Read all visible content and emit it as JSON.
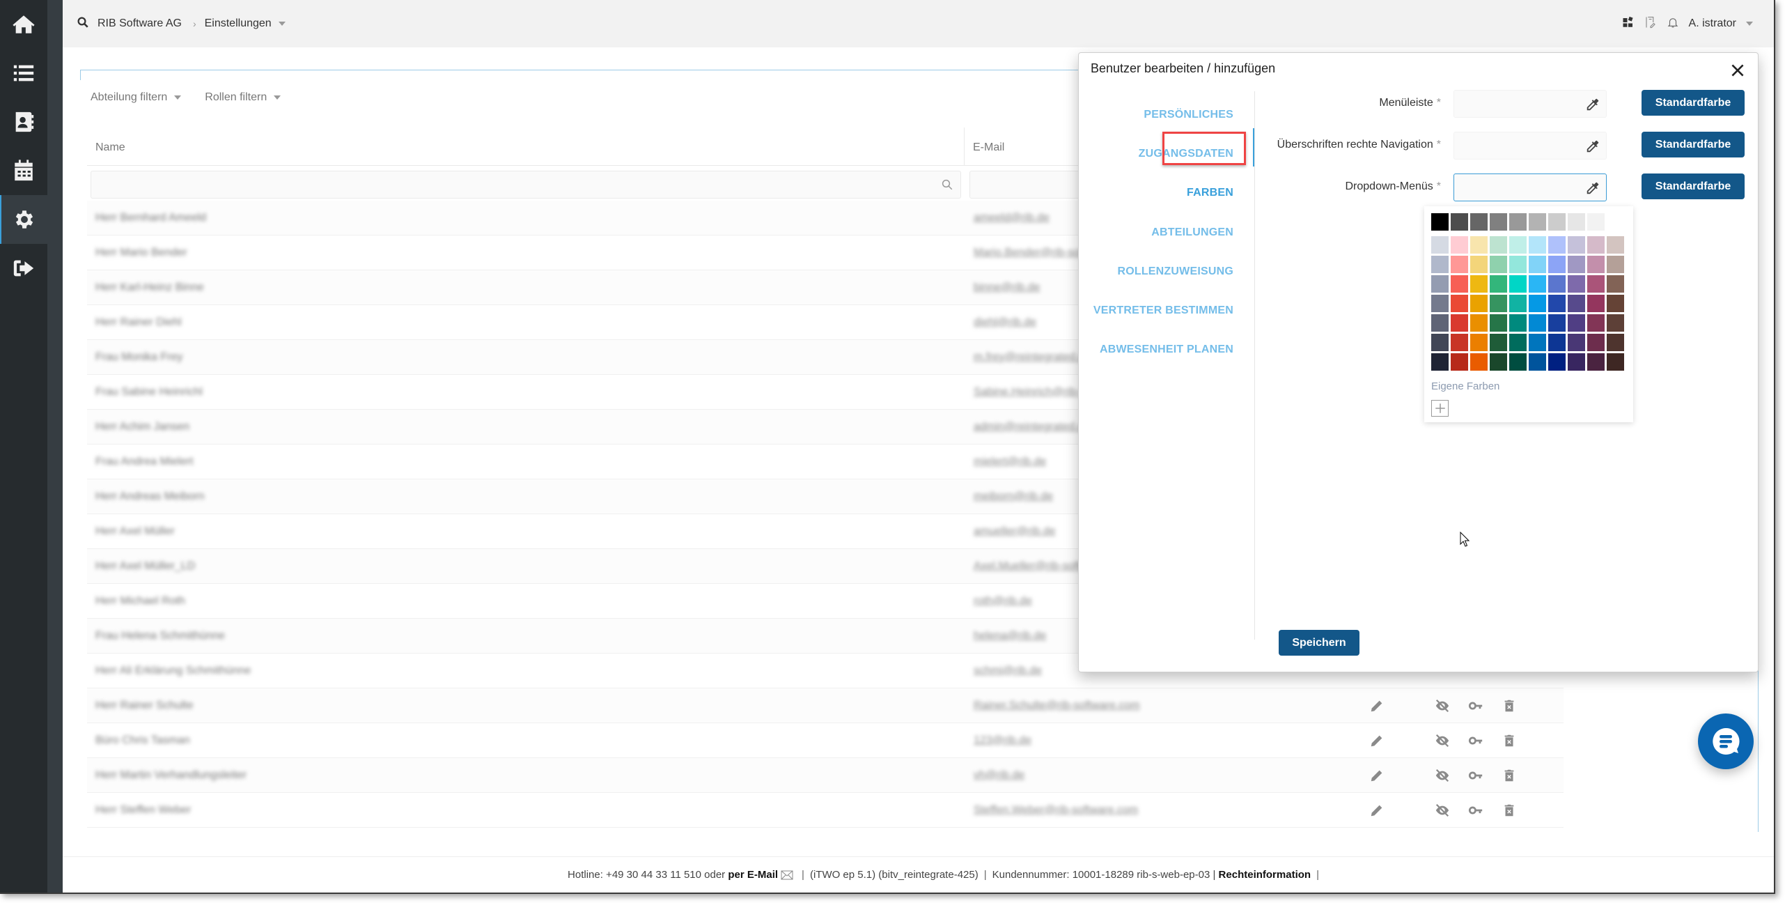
{
  "sidebar": {
    "items": [
      {
        "name": "home",
        "icon": "home-icon"
      },
      {
        "name": "list",
        "icon": "list-icon"
      },
      {
        "name": "contacts",
        "icon": "address-book-icon"
      },
      {
        "name": "calendar",
        "icon": "calendar-icon"
      },
      {
        "name": "settings",
        "icon": "gear-icon",
        "active": true
      },
      {
        "name": "logout",
        "icon": "sign-out-icon"
      }
    ]
  },
  "topbar": {
    "breadcrumb": [
      "RIB Software AG",
      "Einstellungen"
    ],
    "user": "A. istrator"
  },
  "filters": {
    "department": "Abteilung filtern",
    "roles": "Rollen filtern"
  },
  "table": {
    "columns": [
      "Name",
      "E-Mail"
    ],
    "rows": [
      {
        "name": "Herr Bernhard Ameeld",
        "email": "ameeld@rib.de"
      },
      {
        "name": "Herr Mario Bender",
        "email": "Mario.Bender@rib-software.com"
      },
      {
        "name": "Herr Karl-Heinz Binne",
        "email": "binne@rib.de"
      },
      {
        "name": "Herr Rainer Diehl",
        "email": "diehl@rib.de"
      },
      {
        "name": "Frau Monika Frey",
        "email": "m.frey@reintegrated.de"
      },
      {
        "name": "Frau Sabine Heinrichl",
        "email": "Sabine.Heinrich@rib-software.com"
      },
      {
        "name": "Herr Achim Jansen",
        "email": "admin@reintegrated.de"
      },
      {
        "name": "Frau Andrea Mielert",
        "email": "mielert@rib.de"
      },
      {
        "name": "Herr Andreas Meiborn",
        "email": "meiborn@rib.de"
      },
      {
        "name": "Herr Axel Müller",
        "email": "amueller@rib.de"
      },
      {
        "name": "Herr Axel Müller_LD",
        "email": "Axel.Mueller@rib-software.com"
      },
      {
        "name": "Herr Michael Roth",
        "email": "roth@rib.de"
      },
      {
        "name": "Frau Helena Schmithünne",
        "email": "helena@rib.de"
      },
      {
        "name": "Herr Ali Erklärung Schmithünne",
        "email": "schmi@rib.de"
      },
      {
        "name": "Herr Rainer Schulte",
        "email": "Rainer.Schulte@rib-software.com"
      },
      {
        "name": "Büro Chris Tasman",
        "email": "123@rib.de"
      },
      {
        "name": "Herr Martin Verhandlungsleiter",
        "email": "vh@rib.de"
      },
      {
        "name": "Herr Steffen Weber",
        "email": "Steffen.Weber@rib-software.com"
      }
    ],
    "row_actions": [
      "edit-icon",
      "visibility-off-icon",
      "key-icon",
      "trash-icon"
    ]
  },
  "modal": {
    "title": "Benutzer bearbeiten / hinzufügen",
    "nav": [
      "PERSÖNLICHES",
      "ZUGANGSDATEN",
      "FARBEN",
      "ABTEILUNGEN",
      "ROLLENZUWEISUNG",
      "VERTRETER BESTIMMEN",
      "ABWESENHEIT PLANEN"
    ],
    "active_nav": "FARBEN",
    "fields": [
      {
        "label": "Menüleiste",
        "required": "*",
        "value": "",
        "button": "Standardfarbe"
      },
      {
        "label": "Überschriften rechte Navigation",
        "required": "*",
        "value": "",
        "button": "Standardfarbe"
      },
      {
        "label": "Dropdown-Menüs",
        "required": "*",
        "value": "",
        "button": "Standardfarbe",
        "focused": true
      }
    ],
    "palette": {
      "grays": [
        "#000000",
        "#4d4d4d",
        "#666666",
        "#808080",
        "#999999",
        "#b3b3b3",
        "#cccccc",
        "#e6e6e6",
        "#f2f2f2"
      ],
      "rows": [
        [
          "#d5dae3",
          "#ffccd3",
          "#f8e5ad",
          "#bde3d0",
          "#c0efe8",
          "#b3e5fa",
          "#afc1fb",
          "#c5c1da",
          "#d5bac9",
          "#d3c4c0"
        ],
        [
          "#b0b8cb",
          "#ff9896",
          "#f3d57a",
          "#8fd1ad",
          "#93e7dc",
          "#81d3f8",
          "#8ca4f6",
          "#a098c3",
          "#c38fab",
          "#b4a098"
        ],
        [
          "#949cb1",
          "#f75f55",
          "#eeb812",
          "#33b67b",
          "#00d6c6",
          "#2ab6f5",
          "#5b76ce",
          "#7e6aab",
          "#aa5479",
          "#826356"
        ],
        [
          "#747a8d",
          "#ea4935",
          "#eaa200",
          "#369460",
          "#11b3a3",
          "#0599e5",
          "#2248ab",
          "#574a8c",
          "#94365e",
          "#654336"
        ],
        [
          "#5f6476",
          "#d9392e",
          "#ea8f00",
          "#267548",
          "#008a7e",
          "#0289d4",
          "#183f9e",
          "#503e84",
          "#823556",
          "#5d4037"
        ],
        [
          "#414656",
          "#c83526",
          "#eb7f00",
          "#1f5c38",
          "#006c5d",
          "#0075bd",
          "#0d3694",
          "#493775",
          "#6d2d4d",
          "#4e342e"
        ],
        [
          "#1f2435",
          "#b72a1a",
          "#e95c00",
          "#1a472b",
          "#004d40",
          "#00549c",
          "#002081",
          "#382660",
          "#4a2340",
          "#3e2723"
        ]
      ],
      "own_colors_label": "Eigene Farben"
    },
    "save_label": "Speichern"
  },
  "footer": {
    "hotline": "Hotline: +49 30 44 33 11 510 oder",
    "email_link": "per E-Mail",
    "version": "(iTWO ep 5.1) (bitv_reintegrate-425)",
    "customer": "Kundennummer: 10001-18289 rib-s-web-ep-03 |",
    "rights_link": "Rechteinformation",
    "sep": "|"
  },
  "colors": {
    "primary_button": "#135789",
    "nav_link": "#74bde9",
    "accent": "#3aa0db",
    "highlight_box": "#ef4444",
    "chat": "#0a66b2",
    "sidebar": "#262b2e"
  }
}
